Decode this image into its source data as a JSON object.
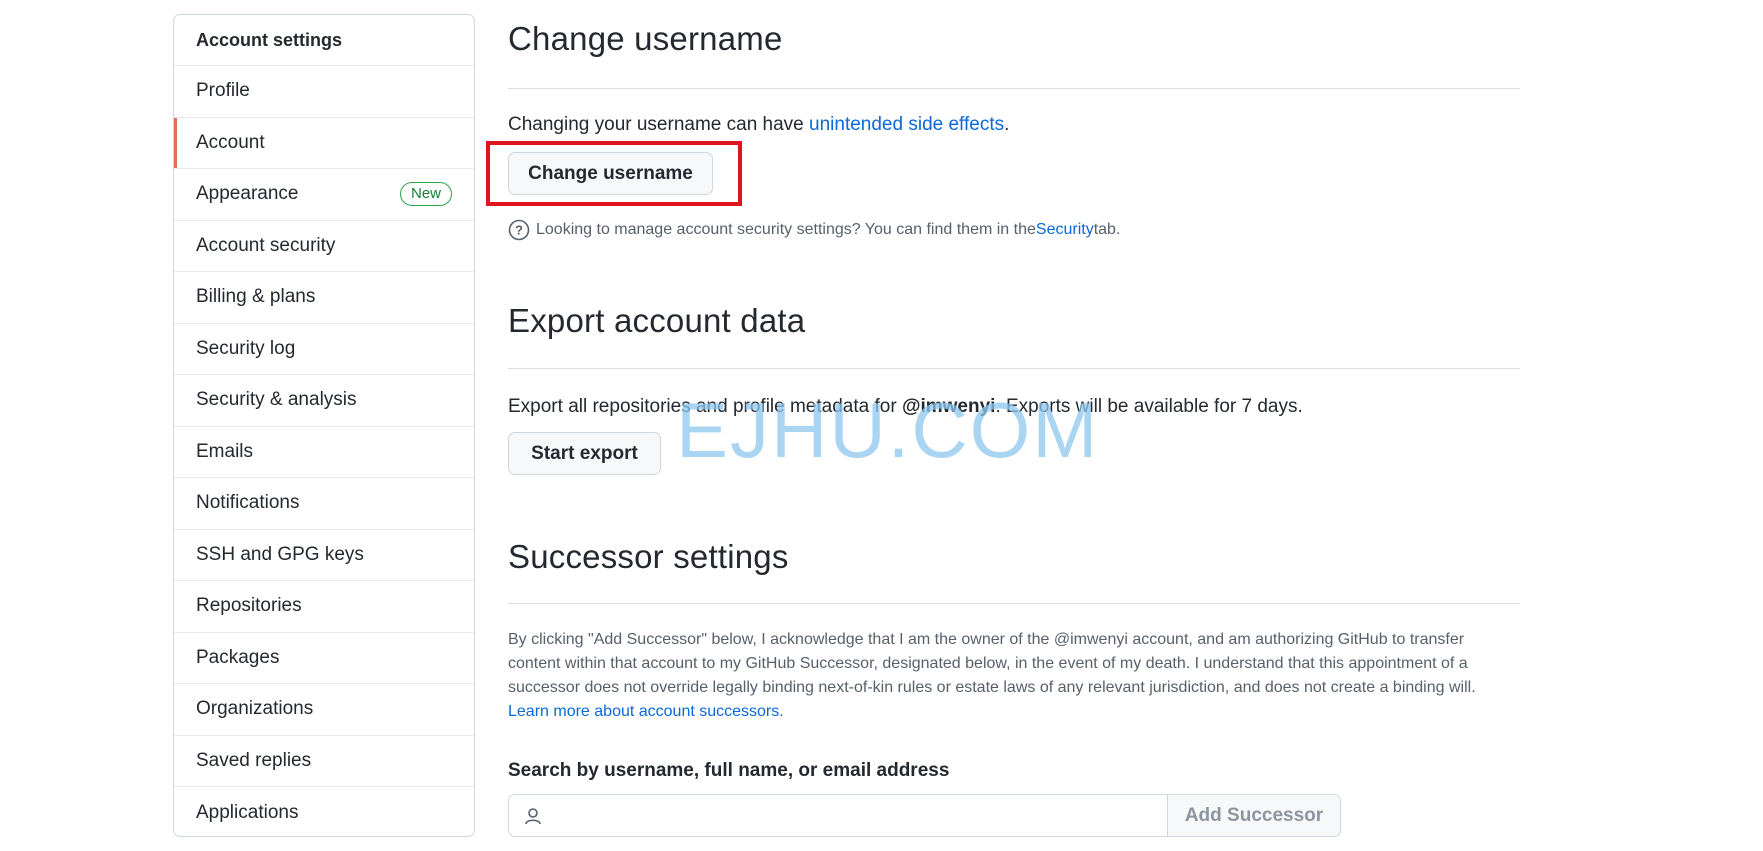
{
  "sidebar": {
    "heading": "Account settings",
    "items": [
      {
        "label": "Profile"
      },
      {
        "label": "Account",
        "selected": true
      },
      {
        "label": "Appearance",
        "badge": "New"
      },
      {
        "label": "Account security"
      },
      {
        "label": "Billing & plans"
      },
      {
        "label": "Security log"
      },
      {
        "label": "Security & analysis"
      },
      {
        "label": "Emails"
      },
      {
        "label": "Notifications"
      },
      {
        "label": "SSH and GPG keys"
      },
      {
        "label": "Repositories"
      },
      {
        "label": "Packages"
      },
      {
        "label": "Organizations"
      },
      {
        "label": "Saved replies"
      },
      {
        "label": "Applications"
      }
    ]
  },
  "change_username": {
    "title": "Change username",
    "desc_prefix": "Changing your username can have ",
    "desc_link": "unintended side effects",
    "desc_suffix": ".",
    "button": "Change username",
    "note_prefix": "Looking to manage account security settings? You can find them in the ",
    "note_link": "Security",
    "note_suffix": " tab."
  },
  "export": {
    "title": "Export account data",
    "desc_prefix": "Export all repositories and profile metadata for ",
    "username": "@imwenyi",
    "desc_suffix": ". Exports will be available for 7 days.",
    "button": "Start export"
  },
  "successor": {
    "title": "Successor settings",
    "paragraph": "By clicking \"Add Successor\" below, I acknowledge that I am the owner of the @imwenyi account, and am authorizing GitHub to transfer content within that account to my GitHub Successor, designated below, in the event of my death. I understand that this appointment of a successor does not override legally binding next-of-kin rules or estate laws of any relevant jurisdiction, and does not create a binding will.",
    "learn_more": "Learn more about account successors",
    "learn_more_suffix": ".",
    "search_label": "Search by username, full name, or email address",
    "search_placeholder": "",
    "add_button": "Add Successor"
  },
  "watermark": "EJHU.COM",
  "colors": {
    "link": "#0969da",
    "selected_indicator": "#e16f56",
    "badge_green": "#1a7f37",
    "highlight_red": "#e0141e"
  }
}
